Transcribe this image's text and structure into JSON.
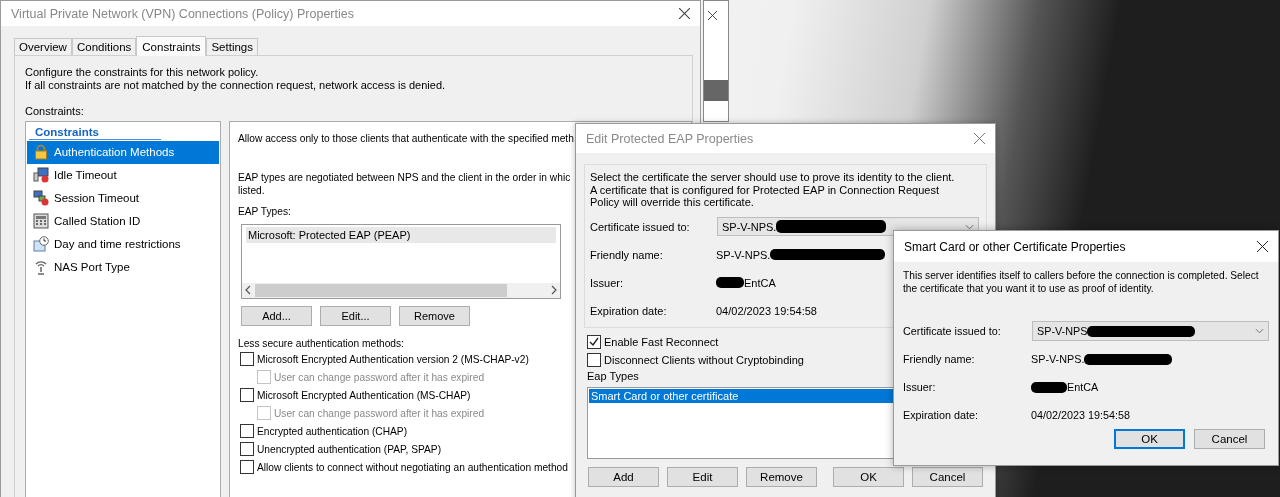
{
  "main_window": {
    "title": "Virtual Private Network (VPN) Connections (Policy) Properties",
    "tabs": [
      {
        "label": "Overview",
        "selected": false
      },
      {
        "label": "Conditions",
        "selected": false
      },
      {
        "label": "Constraints",
        "selected": true
      },
      {
        "label": "Settings",
        "selected": false
      }
    ],
    "intro_lines": [
      "Configure the constraints for this network policy.",
      "If all constraints are not matched by the connection request, network access is denied."
    ],
    "constraints_label": "Constraints:",
    "sidebar": {
      "heading": "Constraints",
      "items": [
        {
          "label": "Authentication Methods",
          "selected": true
        },
        {
          "label": "Idle Timeout",
          "selected": false
        },
        {
          "label": "Session Timeout",
          "selected": false
        },
        {
          "label": "Called Station ID",
          "selected": false
        },
        {
          "label": "Day and time restrictions",
          "selected": false
        },
        {
          "label": "NAS Port Type",
          "selected": false
        }
      ]
    },
    "panel": {
      "allow_text": "Allow access only to those clients that authenticate with the specified meth",
      "eap_note_lines": [
        "EAP types are negotiated between NPS and the client in the order in whic",
        "listed."
      ],
      "eap_types_label": "EAP Types:",
      "eap_types": [
        {
          "label": "Microsoft: Protected EAP (PEAP)",
          "selected": true
        }
      ],
      "buttons": [
        {
          "label": "Add..."
        },
        {
          "label": "Edit..."
        },
        {
          "label": "Remove"
        }
      ],
      "less_secure_label": "Less secure authentication methods:",
      "methods": [
        {
          "label": "Microsoft Encrypted Authentication version 2 (MS-CHAP-v2)",
          "checked": false,
          "disabled": false,
          "children": [
            {
              "label": "User can change password after it has expired",
              "checked": false,
              "disabled": true
            }
          ]
        },
        {
          "label": "Microsoft Encrypted Authentication (MS-CHAP)",
          "checked": false,
          "disabled": false,
          "children": [
            {
              "label": "User can change password after it has expired",
              "checked": false,
              "disabled": true
            }
          ]
        },
        {
          "label": "Encrypted authentication (CHAP)",
          "checked": false,
          "disabled": false
        },
        {
          "label": "Unencrypted authentication (PAP, SPAP)",
          "checked": false,
          "disabled": false
        },
        {
          "label": "Allow clients to connect without negotiating an authentication method",
          "checked": false,
          "disabled": false
        }
      ]
    }
  },
  "eap_dialog": {
    "title": "Edit Protected EAP Properties",
    "description_lines": [
      "Select the certificate the server should use to prove its identity to the client.",
      "A certificate that is configured for Protected EAP in Connection Request",
      "Policy will override this certificate."
    ],
    "fields": [
      {
        "label": "Certificate issued to:",
        "value": "SP-V-NPS.",
        "kind": "combo"
      },
      {
        "label": "Friendly name:",
        "value": "SP-V-NPS.",
        "kind": "text"
      },
      {
        "label": "Issuer:",
        "value": "EntCA",
        "kind": "text"
      },
      {
        "label": "Expiration date:",
        "value": "04/02/2023 19:54:58",
        "kind": "text"
      }
    ],
    "options": [
      {
        "label": "Enable Fast Reconnect",
        "checked": true
      },
      {
        "label": "Disconnect Clients without Cryptobinding",
        "checked": false
      }
    ],
    "eap_types_label": "Eap Types",
    "eap_types": [
      {
        "label": "Smart Card or other certificate",
        "selected": true
      }
    ],
    "buttons": [
      {
        "label": "Add",
        "default": false
      },
      {
        "label": "Edit",
        "default": false
      },
      {
        "label": "Remove",
        "default": false
      },
      {
        "label": "OK",
        "default": false
      },
      {
        "label": "Cancel",
        "default": false
      }
    ]
  },
  "cert_dialog": {
    "title": "Smart Card or other Certificate Properties",
    "description_lines": [
      "This server identifies itself to callers before the connection is completed. Select",
      "the certificate that you want it to use as proof of identity."
    ],
    "fields": [
      {
        "label": "Certificate issued to:",
        "value": "SP-V-NPS",
        "kind": "combo"
      },
      {
        "label": "Friendly name:",
        "value": "SP-V-NPS.",
        "kind": "text"
      },
      {
        "label": "Issuer:",
        "value": "EntCA",
        "kind": "text"
      },
      {
        "label": "Expiration date:",
        "value": "04/02/2023 19:54:58",
        "kind": "text"
      }
    ],
    "buttons": [
      {
        "label": "OK",
        "default": true
      },
      {
        "label": "Cancel",
        "default": false
      }
    ]
  }
}
